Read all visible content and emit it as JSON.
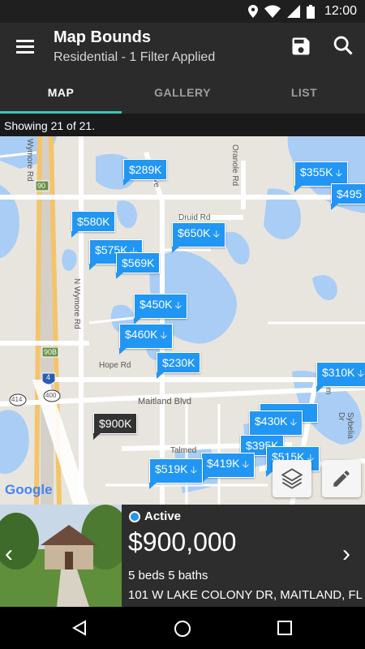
{
  "status_bar": {
    "time": "12:00"
  },
  "app_bar": {
    "title": "Map Bounds",
    "subtitle": "Residential - 1 Filter Applied"
  },
  "tabs": [
    {
      "label": "MAP",
      "active": true
    },
    {
      "label": "GALLERY",
      "active": false
    },
    {
      "label": "LIST",
      "active": false
    }
  ],
  "results": {
    "showing": "Showing 21 of 21."
  },
  "map": {
    "road_labels": [
      "Druid Rd",
      "Oranole Rd",
      "N Wymore Rd",
      "Wymore Rd",
      "Hope Rd",
      "Maitland Blvd",
      "Talmed",
      "Sybelia Dr",
      "Ave",
      "Salem"
    ],
    "highway_shields": [
      "90",
      "90B",
      "4",
      "400",
      "414"
    ],
    "attribution": "Google",
    "pins": [
      {
        "label": "$289K",
        "arrow": false,
        "style": "blue"
      },
      {
        "label": "$355K",
        "arrow": true,
        "style": "blue"
      },
      {
        "label": "$495",
        "arrow": false,
        "style": "blue"
      },
      {
        "label": "$580K",
        "arrow": false,
        "style": "blue"
      },
      {
        "label": "$650K",
        "arrow": true,
        "style": "blue"
      },
      {
        "label": "$575K",
        "arrow": true,
        "style": "blue"
      },
      {
        "label": "$569K",
        "arrow": false,
        "style": "blue"
      },
      {
        "label": "$450K",
        "arrow": true,
        "style": "blue"
      },
      {
        "label": "$460K",
        "arrow": true,
        "style": "blue"
      },
      {
        "label": "$230K",
        "arrow": false,
        "style": "blue"
      },
      {
        "label": "$310K",
        "arrow": true,
        "style": "blue"
      },
      {
        "label": "$900K",
        "arrow": false,
        "style": "dark"
      },
      {
        "label": "$430K",
        "arrow": true,
        "style": "blue"
      },
      {
        "label": "$395K",
        "arrow": false,
        "style": "blue"
      },
      {
        "label": "$515K",
        "arrow": true,
        "style": "blue"
      },
      {
        "label": "$419K",
        "arrow": true,
        "style": "blue"
      },
      {
        "label": "$519K",
        "arrow": true,
        "style": "blue"
      }
    ],
    "layers_icon": "layers-icon",
    "draw_icon": "pencil-icon"
  },
  "listing": {
    "status": "Active",
    "status_color": "#2196f3",
    "price": "$900,000",
    "beds_baths": "5 beds 5 baths",
    "address": "101 W LAKE COLONY DR, MAITLAND, FL"
  },
  "colors": {
    "accent": "#3dc3b8",
    "pin": "#2196f3",
    "app_bar": "#2b2b2b"
  }
}
